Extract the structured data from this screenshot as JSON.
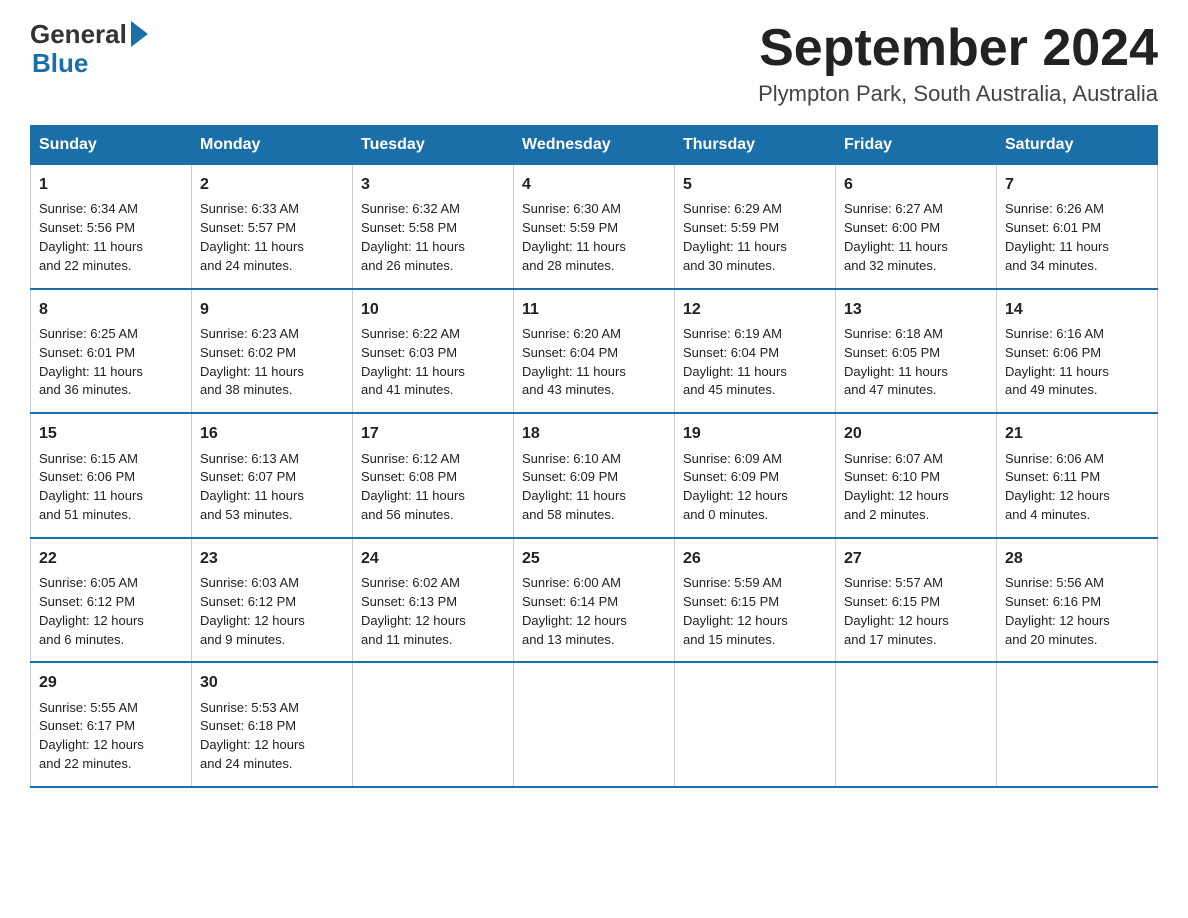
{
  "header": {
    "logo_general": "General",
    "logo_blue": "Blue",
    "month_title": "September 2024",
    "location": "Plympton Park, South Australia, Australia"
  },
  "days_of_week": [
    "Sunday",
    "Monday",
    "Tuesday",
    "Wednesday",
    "Thursday",
    "Friday",
    "Saturday"
  ],
  "weeks": [
    [
      {
        "day": "1",
        "sunrise": "6:34 AM",
        "sunset": "5:56 PM",
        "daylight": "11 hours and 22 minutes."
      },
      {
        "day": "2",
        "sunrise": "6:33 AM",
        "sunset": "5:57 PM",
        "daylight": "11 hours and 24 minutes."
      },
      {
        "day": "3",
        "sunrise": "6:32 AM",
        "sunset": "5:58 PM",
        "daylight": "11 hours and 26 minutes."
      },
      {
        "day": "4",
        "sunrise": "6:30 AM",
        "sunset": "5:59 PM",
        "daylight": "11 hours and 28 minutes."
      },
      {
        "day": "5",
        "sunrise": "6:29 AM",
        "sunset": "5:59 PM",
        "daylight": "11 hours and 30 minutes."
      },
      {
        "day": "6",
        "sunrise": "6:27 AM",
        "sunset": "6:00 PM",
        "daylight": "11 hours and 32 minutes."
      },
      {
        "day": "7",
        "sunrise": "6:26 AM",
        "sunset": "6:01 PM",
        "daylight": "11 hours and 34 minutes."
      }
    ],
    [
      {
        "day": "8",
        "sunrise": "6:25 AM",
        "sunset": "6:01 PM",
        "daylight": "11 hours and 36 minutes."
      },
      {
        "day": "9",
        "sunrise": "6:23 AM",
        "sunset": "6:02 PM",
        "daylight": "11 hours and 38 minutes."
      },
      {
        "day": "10",
        "sunrise": "6:22 AM",
        "sunset": "6:03 PM",
        "daylight": "11 hours and 41 minutes."
      },
      {
        "day": "11",
        "sunrise": "6:20 AM",
        "sunset": "6:04 PM",
        "daylight": "11 hours and 43 minutes."
      },
      {
        "day": "12",
        "sunrise": "6:19 AM",
        "sunset": "6:04 PM",
        "daylight": "11 hours and 45 minutes."
      },
      {
        "day": "13",
        "sunrise": "6:18 AM",
        "sunset": "6:05 PM",
        "daylight": "11 hours and 47 minutes."
      },
      {
        "day": "14",
        "sunrise": "6:16 AM",
        "sunset": "6:06 PM",
        "daylight": "11 hours and 49 minutes."
      }
    ],
    [
      {
        "day": "15",
        "sunrise": "6:15 AM",
        "sunset": "6:06 PM",
        "daylight": "11 hours and 51 minutes."
      },
      {
        "day": "16",
        "sunrise": "6:13 AM",
        "sunset": "6:07 PM",
        "daylight": "11 hours and 53 minutes."
      },
      {
        "day": "17",
        "sunrise": "6:12 AM",
        "sunset": "6:08 PM",
        "daylight": "11 hours and 56 minutes."
      },
      {
        "day": "18",
        "sunrise": "6:10 AM",
        "sunset": "6:09 PM",
        "daylight": "11 hours and 58 minutes."
      },
      {
        "day": "19",
        "sunrise": "6:09 AM",
        "sunset": "6:09 PM",
        "daylight": "12 hours and 0 minutes."
      },
      {
        "day": "20",
        "sunrise": "6:07 AM",
        "sunset": "6:10 PM",
        "daylight": "12 hours and 2 minutes."
      },
      {
        "day": "21",
        "sunrise": "6:06 AM",
        "sunset": "6:11 PM",
        "daylight": "12 hours and 4 minutes."
      }
    ],
    [
      {
        "day": "22",
        "sunrise": "6:05 AM",
        "sunset": "6:12 PM",
        "daylight": "12 hours and 6 minutes."
      },
      {
        "day": "23",
        "sunrise": "6:03 AM",
        "sunset": "6:12 PM",
        "daylight": "12 hours and 9 minutes."
      },
      {
        "day": "24",
        "sunrise": "6:02 AM",
        "sunset": "6:13 PM",
        "daylight": "12 hours and 11 minutes."
      },
      {
        "day": "25",
        "sunrise": "6:00 AM",
        "sunset": "6:14 PM",
        "daylight": "12 hours and 13 minutes."
      },
      {
        "day": "26",
        "sunrise": "5:59 AM",
        "sunset": "6:15 PM",
        "daylight": "12 hours and 15 minutes."
      },
      {
        "day": "27",
        "sunrise": "5:57 AM",
        "sunset": "6:15 PM",
        "daylight": "12 hours and 17 minutes."
      },
      {
        "day": "28",
        "sunrise": "5:56 AM",
        "sunset": "6:16 PM",
        "daylight": "12 hours and 20 minutes."
      }
    ],
    [
      {
        "day": "29",
        "sunrise": "5:55 AM",
        "sunset": "6:17 PM",
        "daylight": "12 hours and 22 minutes."
      },
      {
        "day": "30",
        "sunrise": "5:53 AM",
        "sunset": "6:18 PM",
        "daylight": "12 hours and 24 minutes."
      },
      null,
      null,
      null,
      null,
      null
    ]
  ],
  "labels": {
    "sunrise": "Sunrise:",
    "sunset": "Sunset:",
    "daylight": "Daylight:"
  }
}
